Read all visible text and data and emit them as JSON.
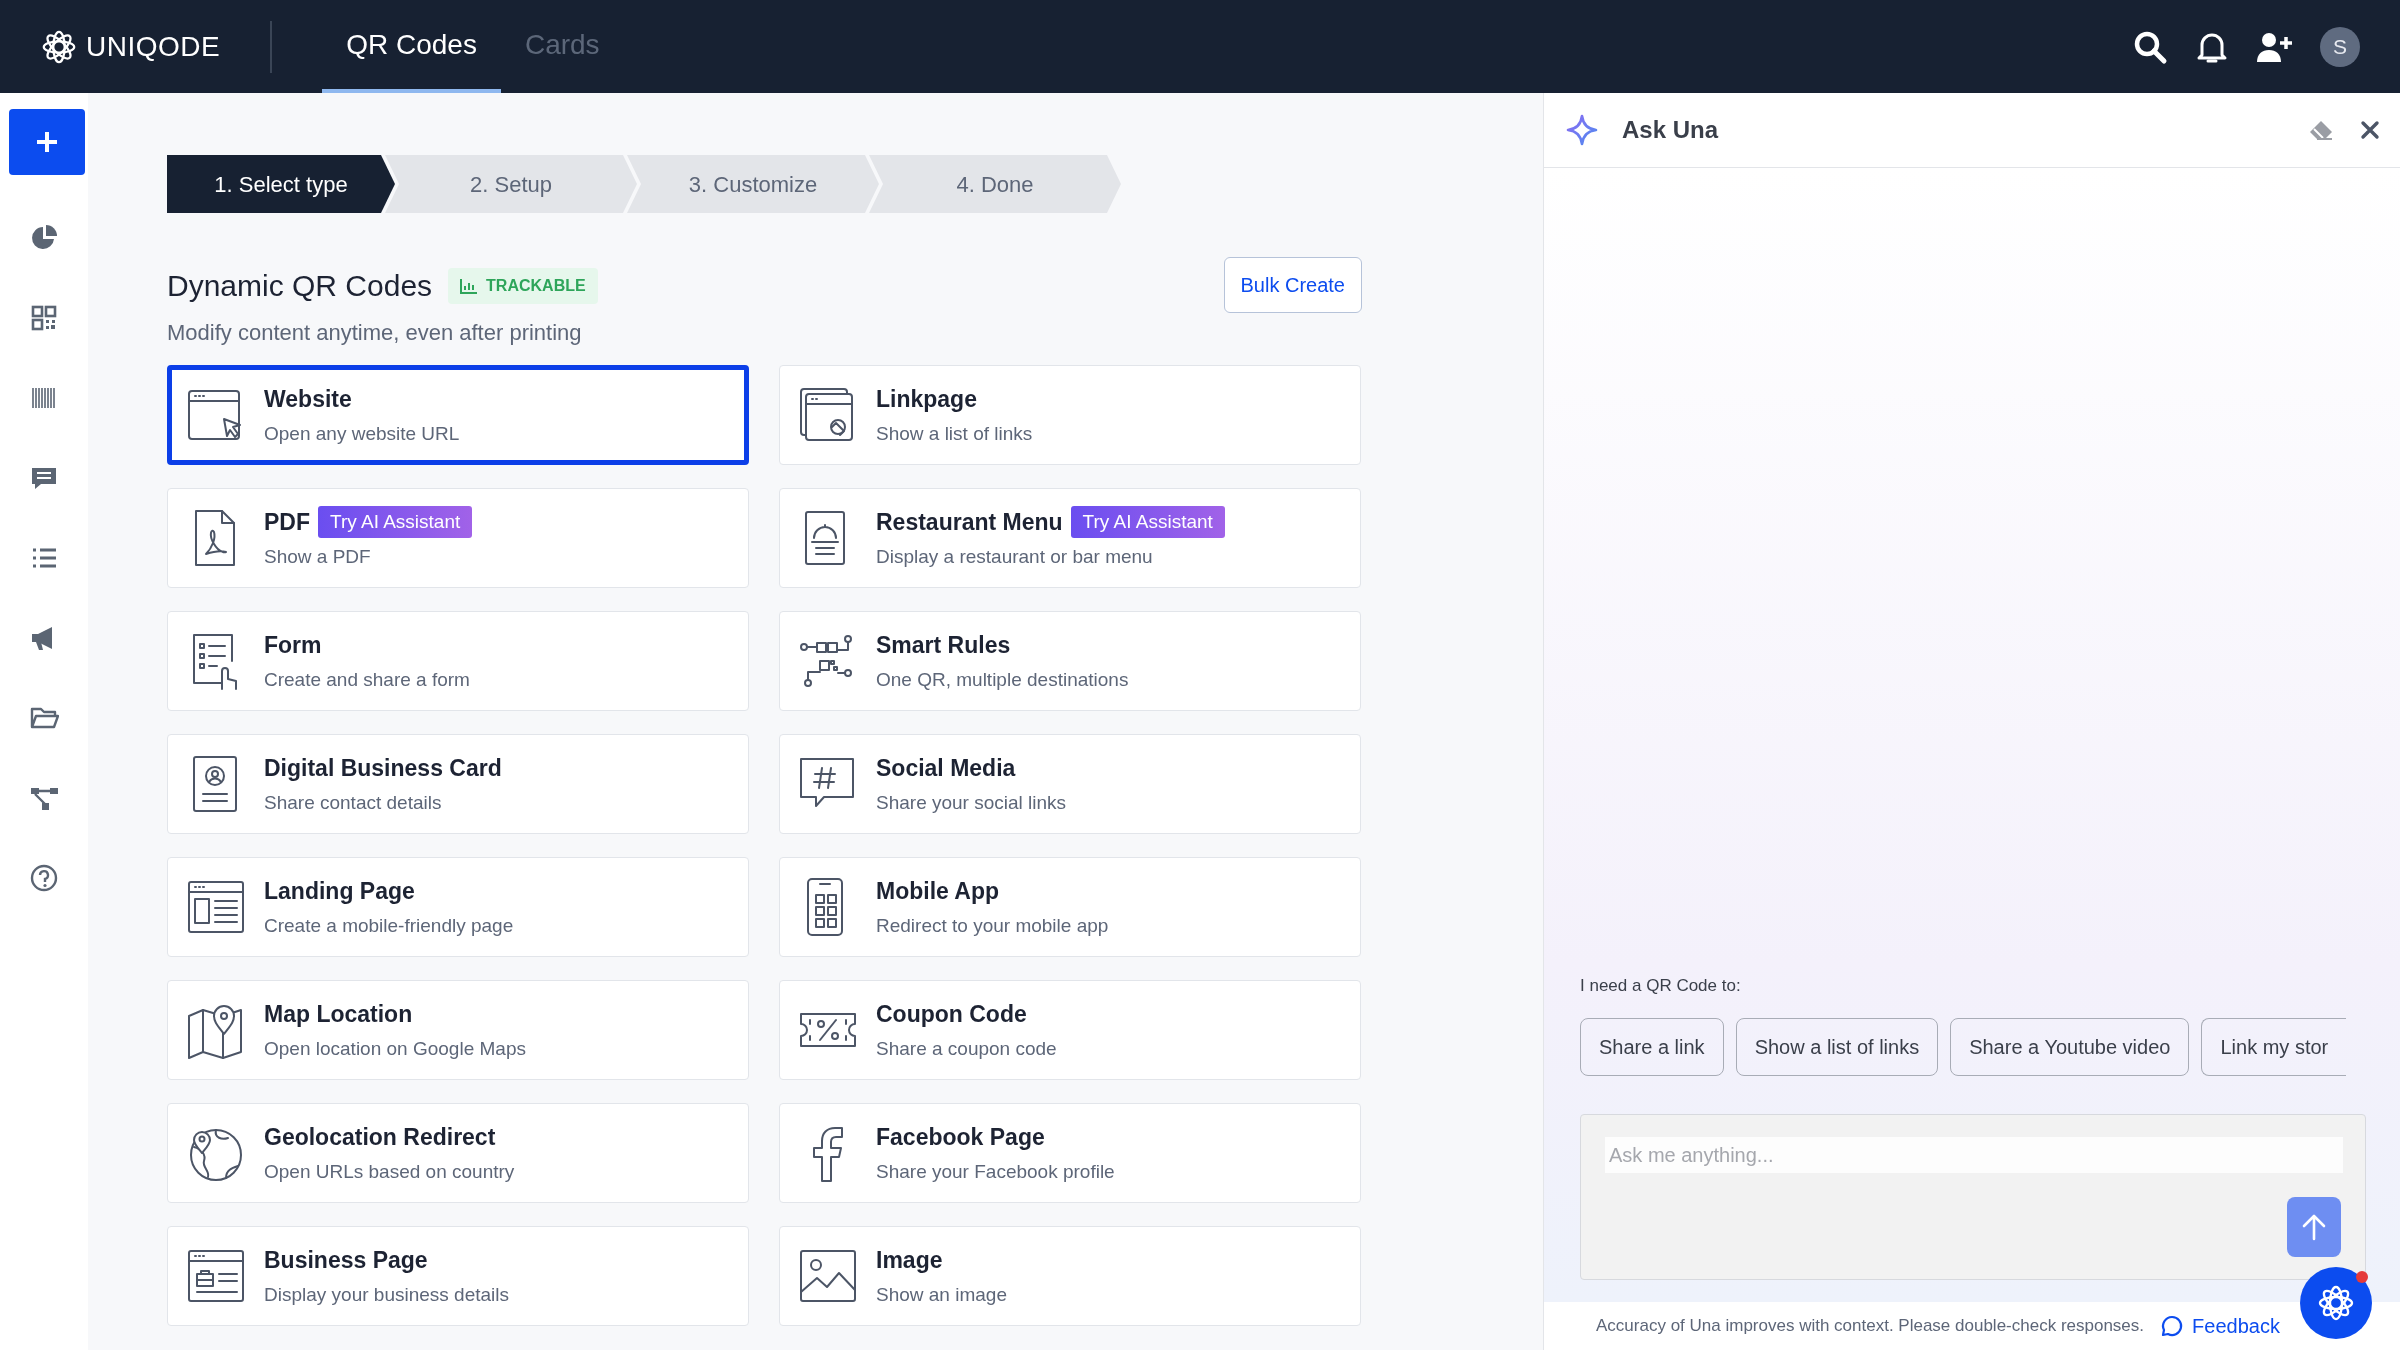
{
  "brand": {
    "name": "UNIQODE"
  },
  "tabs": [
    {
      "label": "QR Codes",
      "selected": true
    },
    {
      "label": "Cards",
      "selected": false
    }
  ],
  "user": {
    "initial": "S"
  },
  "steps": [
    {
      "label": "1. Select type",
      "selected": true
    },
    {
      "label": "2. Setup",
      "selected": false
    },
    {
      "label": "3. Customize",
      "selected": false
    },
    {
      "label": "4. Done",
      "selected": false
    }
  ],
  "section": {
    "title": "Dynamic QR Codes",
    "tag": "TRACKABLE",
    "subtitle": "Modify content anytime, even after printing",
    "action": "Bulk Create"
  },
  "types": [
    {
      "title": "Website",
      "subtitle": "Open any website URL",
      "selected": true
    },
    {
      "title": "Linkpage",
      "subtitle": "Show a list of links",
      "selected": false
    },
    {
      "title": "PDF",
      "badge": "Try AI Assistant",
      "subtitle": "Show a PDF",
      "selected": false
    },
    {
      "title": "Restaurant Menu",
      "badge": "Try AI Assistant",
      "subtitle": "Display a restaurant or bar menu",
      "selected": false
    },
    {
      "title": "Form",
      "subtitle": "Create and share a form",
      "selected": false
    },
    {
      "title": "Smart Rules",
      "subtitle": "One QR, multiple destinations",
      "selected": false
    },
    {
      "title": "Digital Business Card",
      "subtitle": "Share contact details",
      "selected": false
    },
    {
      "title": "Social Media",
      "subtitle": "Share your social links",
      "selected": false
    },
    {
      "title": "Landing Page",
      "subtitle": "Create a mobile-friendly page",
      "selected": false
    },
    {
      "title": "Mobile App",
      "subtitle": "Redirect to your mobile app",
      "selected": false
    },
    {
      "title": "Map Location",
      "subtitle": "Open location on Google Maps",
      "selected": false
    },
    {
      "title": "Coupon Code",
      "subtitle": "Share a coupon code",
      "selected": false
    },
    {
      "title": "Geolocation Redirect",
      "subtitle": "Open URLs based on country",
      "selected": false
    },
    {
      "title": "Facebook Page",
      "subtitle": "Share your Facebook profile",
      "selected": false
    },
    {
      "title": "Business Page",
      "subtitle": "Display your business details",
      "selected": false
    },
    {
      "title": "Image",
      "subtitle": "Show an image",
      "selected": false
    }
  ],
  "assistant": {
    "title": "Ask Una",
    "prompt": "I need a QR Code to:",
    "suggestions": [
      "Share a link",
      "Show a list of links",
      "Share a Youtube video",
      "Link my stor"
    ],
    "placeholder": "Ask me anything...",
    "disclaimer": "Accuracy of Una improves with context. Please double-check responses.",
    "feedback": "Feedback",
    "notification": true
  }
}
